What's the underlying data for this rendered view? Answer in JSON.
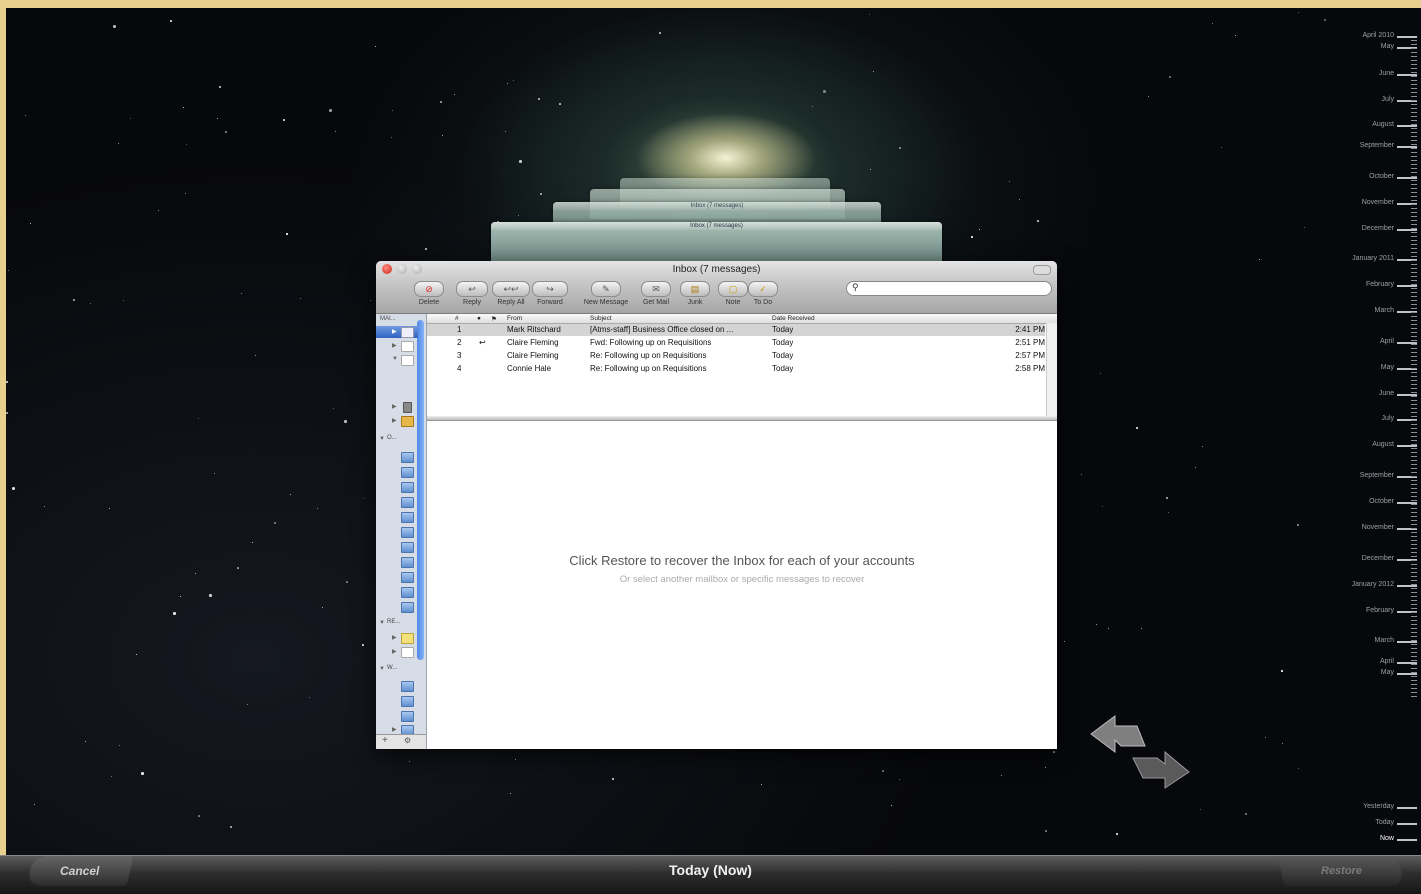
{
  "window": {
    "title": "Inbox (7 messages)",
    "toolbar": [
      {
        "label": "Delete",
        "icon": "⊘"
      },
      {
        "label": "Reply",
        "icon": "↩"
      },
      {
        "label": "Reply All",
        "icon": "↩↩"
      },
      {
        "label": "Forward",
        "icon": "↪"
      },
      {
        "label": "New Message",
        "icon": "✎"
      },
      {
        "label": "Get Mail",
        "icon": "✉"
      },
      {
        "label": "Junk",
        "icon": "▤"
      },
      {
        "label": "Note",
        "icon": "▢"
      },
      {
        "label": "To Do",
        "icon": "✓"
      }
    ],
    "search": {
      "placeholder": ""
    }
  },
  "sidebar": {
    "header": "MAI...",
    "sections": [
      "O...",
      "RE...",
      "W..."
    ]
  },
  "list": {
    "columns": [
      "#",
      "●",
      "⚑",
      "From",
      "Subject",
      "Date Received"
    ],
    "rows": [
      {
        "num": "1",
        "status": "",
        "from": "Mark Ritschard",
        "subject": "[Atms-staff] Business Office closed on ...",
        "date": "Today",
        "time": "2:41 PM"
      },
      {
        "num": "2",
        "status": "↩",
        "from": "Claire Fleming",
        "subject": "Fwd: Following up on Requisitions",
        "date": "Today",
        "time": "2:51 PM"
      },
      {
        "num": "3",
        "status": "",
        "from": "Claire Fleming",
        "subject": "Re: Following up on Requisitions",
        "date": "Today",
        "time": "2:57 PM"
      },
      {
        "num": "4",
        "status": "",
        "from": "Connie Hale",
        "subject": "Re: Following up on Requisitions",
        "date": "Today",
        "time": "2:58 PM"
      }
    ]
  },
  "preview": {
    "message": "Click Restore to recover the Inbox for each of your accounts",
    "submessage": "Or select another mailbox or specific messages to recover"
  },
  "timeline": [
    "April 2010",
    "May",
    "June",
    "July",
    "August",
    "September",
    "October",
    "November",
    "December",
    "January 2011",
    "February",
    "March",
    "April",
    "May",
    "June",
    "July",
    "August",
    "September",
    "October",
    "November",
    "December",
    "January 2012",
    "February",
    "March",
    "April",
    "May",
    "Yesterday",
    "Today",
    "Now"
  ],
  "bottom": {
    "cancel": "Cancel",
    "center": "Today (Now)",
    "restore": "Restore"
  }
}
